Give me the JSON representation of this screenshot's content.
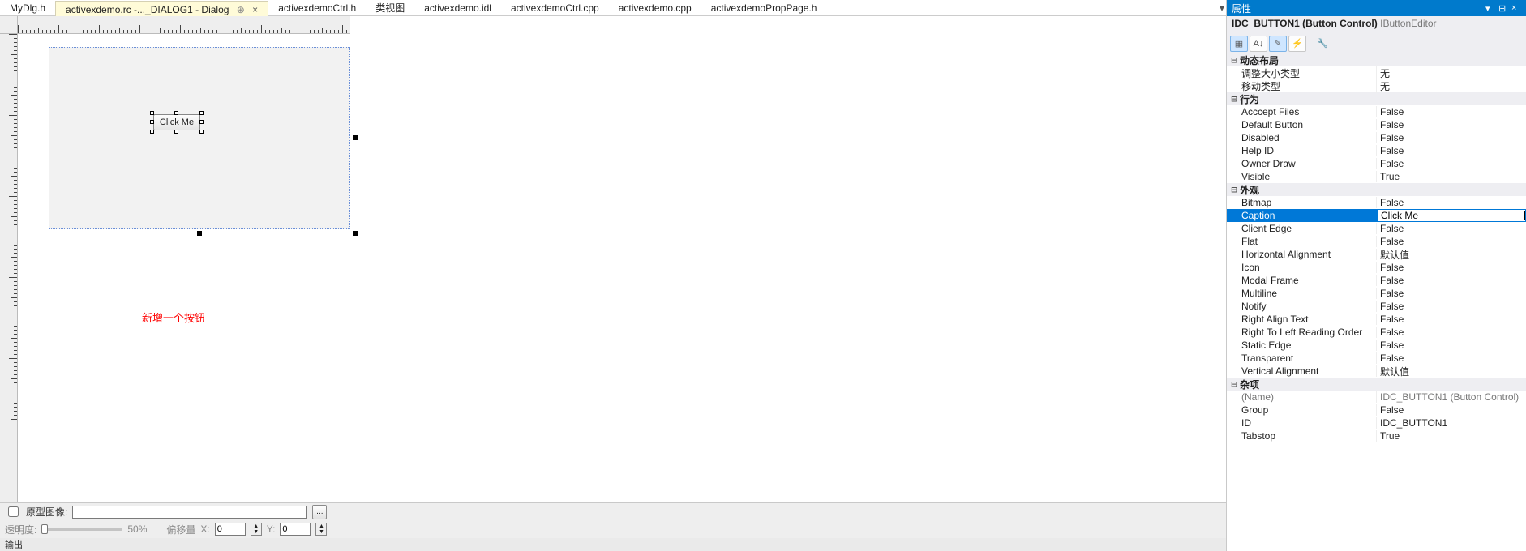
{
  "tabs": {
    "items": [
      {
        "label": "MyDlg.h"
      },
      {
        "label": "activexdemo.rc -..._DIALOG1 - Dialog"
      },
      {
        "label": "activexdemoCtrl.h"
      },
      {
        "label": "类视图"
      },
      {
        "label": "activexdemo.idl"
      },
      {
        "label": "activexdemoCtrl.cpp"
      },
      {
        "label": "activexdemo.cpp"
      },
      {
        "label": "activexdemoPropPage.h"
      }
    ],
    "active_index": 1
  },
  "designer": {
    "button_caption": "Click Me",
    "annotation": "新增一个按钮"
  },
  "bottombar": {
    "proto_label": "原型图像:",
    "proto_value": "",
    "browse_label": "...",
    "opacity_label": "透明度:",
    "opacity_pct": "50%",
    "offset_label": "偏移量",
    "x_label": "X:",
    "x_value": "0",
    "y_label": "Y:",
    "y_value": "0",
    "output_label": "输出"
  },
  "properties": {
    "panel_title": "属性",
    "object_id": "IDC_BUTTON1 (Button Control)",
    "editor": "IButtonEditor",
    "categories": [
      {
        "name": "动态布局",
        "props": [
          {
            "name": "调整大小类型",
            "value": "无"
          },
          {
            "name": "移动类型",
            "value": "无"
          }
        ]
      },
      {
        "name": "行为",
        "props": [
          {
            "name": "Acccept Files",
            "value": "False"
          },
          {
            "name": "Default Button",
            "value": "False"
          },
          {
            "name": "Disabled",
            "value": "False"
          },
          {
            "name": "Help ID",
            "value": "False"
          },
          {
            "name": "Owner Draw",
            "value": "False"
          },
          {
            "name": "Visible",
            "value": "True"
          }
        ]
      },
      {
        "name": "外观",
        "props": [
          {
            "name": "Bitmap",
            "value": "False"
          },
          {
            "name": "Caption",
            "value": "Click Me",
            "selected": true
          },
          {
            "name": "Client Edge",
            "value": "False"
          },
          {
            "name": "Flat",
            "value": "False"
          },
          {
            "name": "Horizontal Alignment",
            "value": "默认值"
          },
          {
            "name": "Icon",
            "value": "False"
          },
          {
            "name": "Modal Frame",
            "value": "False"
          },
          {
            "name": "Multiline",
            "value": "False"
          },
          {
            "name": "Notify",
            "value": "False"
          },
          {
            "name": "Right Align Text",
            "value": "False"
          },
          {
            "name": "Right To Left Reading Order",
            "value": "False"
          },
          {
            "name": "Static Edge",
            "value": "False"
          },
          {
            "name": "Transparent",
            "value": "False"
          },
          {
            "name": "Vertical Alignment",
            "value": "默认值"
          }
        ]
      },
      {
        "name": "杂项",
        "props": [
          {
            "name": "(Name)",
            "value": "IDC_BUTTON1 (Button Control)",
            "gray": true
          },
          {
            "name": "Group",
            "value": "False"
          },
          {
            "name": "ID",
            "value": "IDC_BUTTON1"
          },
          {
            "name": "Tabstop",
            "value": "True"
          }
        ]
      }
    ]
  }
}
